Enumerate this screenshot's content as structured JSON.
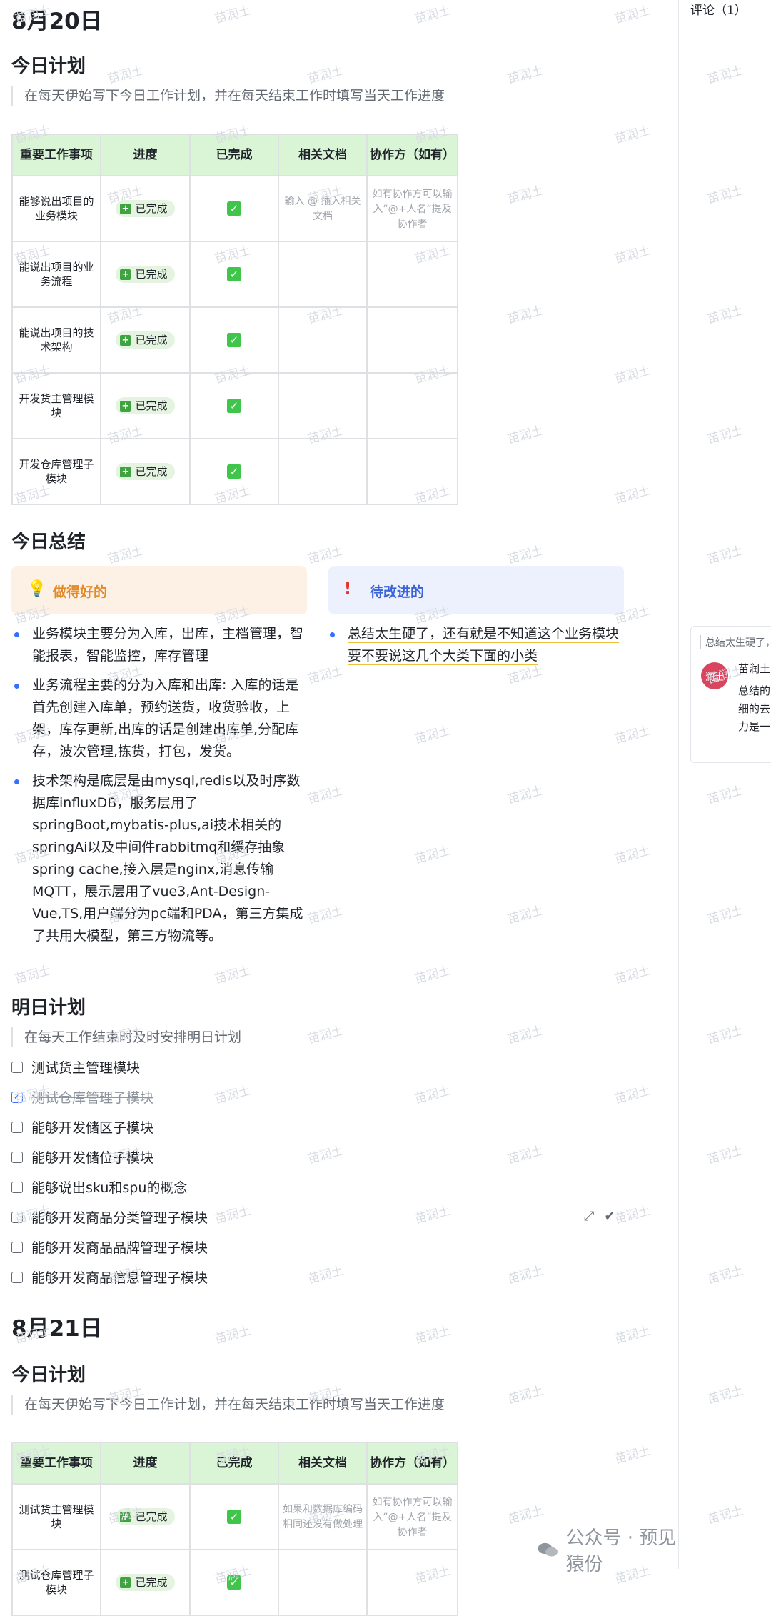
{
  "day1": {
    "date": "8月20日",
    "plan_heading": "今日计划",
    "plan_hint": "在每天伊始写下今日工作计划，并在每天结束工作时填写当天工作进度",
    "table_headers": [
      "重要工作事项",
      "进度",
      "已完成",
      "相关文档",
      "协作方（如有）"
    ],
    "rows": [
      {
        "task": "能够说出项目的业务模块",
        "status": "已完成",
        "doc": "输入 @ 插入相关文档",
        "collab": "如有协作方可以输入“@+人名”提及协作者"
      },
      {
        "task": "能说出项目的业务流程",
        "status": "已完成",
        "doc": "",
        "collab": ""
      },
      {
        "task": "能说出项目的技术架构",
        "status": "已完成",
        "doc": "",
        "collab": ""
      },
      {
        "task": "开发货主管理模块",
        "status": "已完成",
        "doc": "",
        "collab": ""
      },
      {
        "task": "开发仓库管理子模块",
        "status": "已完成",
        "doc": "",
        "collab": ""
      }
    ],
    "summary_heading": "今日总结",
    "good_label": "做得好的",
    "bad_label": "待改进的",
    "good_items": [
      "业务模块主要分为入库，出库，主档管理，智能报表，智能监控，库存管理",
      "业务流程主要的分为入库和出库: 入库的话是首先创建入库单，预约送货，收货验收，上架，库存更新,出库的话是创建出库单,分配库存，波次管理,拣货，打包，发货。",
      "技术架构是底层是由mysql,redis以及时序数据库influxDB，服务层用了springBoot,mybatis-plus,ai技术相关的springAi以及中间件rabbitmq和缓存抽象spring cache,接入层是nginx,消息传输MQTT，展示层用了vue3,Ant-Design-Vue,TS,用户端分为pc端和PDA，第三方集成了共用大模型，第三方物流等。"
    ],
    "bad_items": [
      "总结太生硬了，还有就是不知道这个业务模块要不要说这几个大类下面的小类"
    ],
    "tomorrow_heading": "明日计划",
    "tomorrow_hint": "在每天工作结束时及时安排明日计划",
    "todos": [
      {
        "text": "测试货主管理模块",
        "done": false
      },
      {
        "text": "测试仓库管理子模块",
        "done": true
      },
      {
        "text": "能够开发储区子模块",
        "done": false
      },
      {
        "text": "能够开发储位子模块",
        "done": false
      },
      {
        "text": "能够说出sku和spu的概念",
        "done": false
      },
      {
        "text": "能够开发商品分类管理子模块",
        "done": false
      },
      {
        "text": "能够开发商品品牌管理子模块",
        "done": false
      },
      {
        "text": "能够开发商品信息管理子模块",
        "done": false
      }
    ]
  },
  "day2": {
    "date": "8月21日",
    "plan_heading": "今日计划",
    "plan_hint": "在每天伊始写下今日工作计划，并在每天结束工作时填写当天工作进度",
    "table_headers": [
      "重要工作事项",
      "进度",
      "已完成",
      "相关文档",
      "协作方（如有）"
    ],
    "rows": [
      {
        "task": "测试货主管理模块",
        "status": "已完成",
        "doc": "如果和数据库编码相同还没有做处理",
        "collab": "如有协作方可以输入“@+人名”提及协作者"
      },
      {
        "task": "测试仓库管理子模块",
        "status": "已完成",
        "doc": "",
        "collab": ""
      }
    ]
  },
  "comments": {
    "title": "评论（1）",
    "quote": "总结太生硬了，",
    "avatar_text": "润土",
    "author": "苗润土",
    "text_lines": [
      "总结的",
      "细的去",
      "力是一"
    ]
  },
  "watermark_text": "苗润土",
  "footer": {
    "text": "公众号 · 预见猿份"
  },
  "colors": {
    "table_header_bg": "#d9f5d6",
    "good_bg": "#fdf1e5",
    "bad_bg": "#edf1fd",
    "accent": "#3370ff",
    "done_green": "#3ec54a"
  }
}
